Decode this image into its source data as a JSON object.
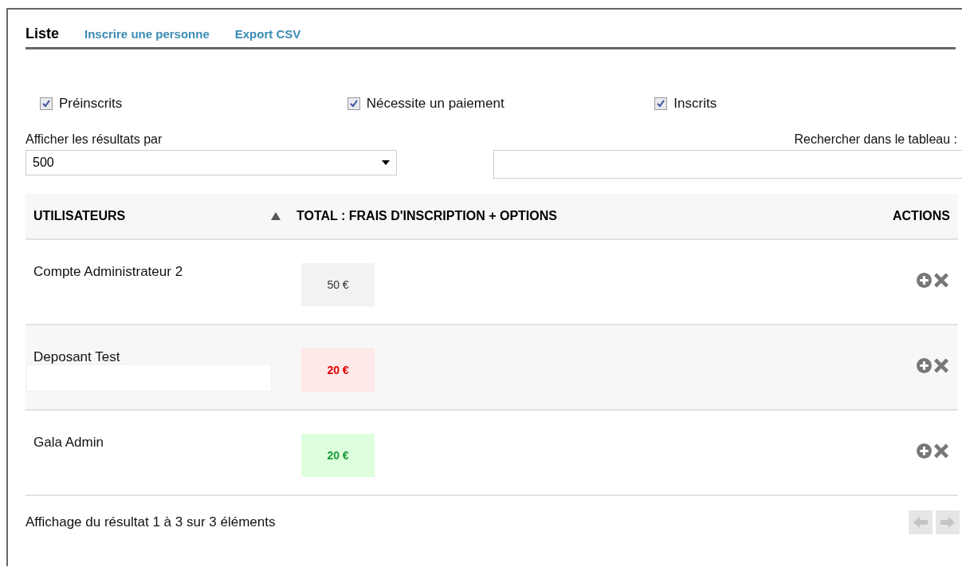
{
  "tabs": [
    {
      "label": "Liste",
      "selected": true
    },
    {
      "label": "Inscrire une personne",
      "selected": false
    },
    {
      "label": "Export CSV",
      "selected": false
    }
  ],
  "filters": [
    {
      "label": "Préinscrits",
      "checked": true
    },
    {
      "label": "Nécessite un paiement",
      "checked": true
    },
    {
      "label": "Inscrits",
      "checked": true
    }
  ],
  "page_size": {
    "label": "Afficher les résultats par",
    "value": "500"
  },
  "search": {
    "label": "Rechercher dans le tableau :"
  },
  "table": {
    "columns": [
      "UTILISATEURS",
      "TOTAL : FRAIS D'INSCRIPTION + OPTIONS",
      "ACTIONS"
    ],
    "rows": [
      {
        "user": "Compte Administrateur 2",
        "total": "50 €",
        "kind": "neutral",
        "redacted": false
      },
      {
        "user": "Deposant Test",
        "total": "20 €",
        "kind": "due",
        "redacted": true
      },
      {
        "user": "Gala Admin",
        "total": "20 €",
        "kind": "paid",
        "redacted": false
      }
    ]
  },
  "footer": {
    "info": "Affichage du résultat 1 à 3 sur 3 éléments"
  }
}
